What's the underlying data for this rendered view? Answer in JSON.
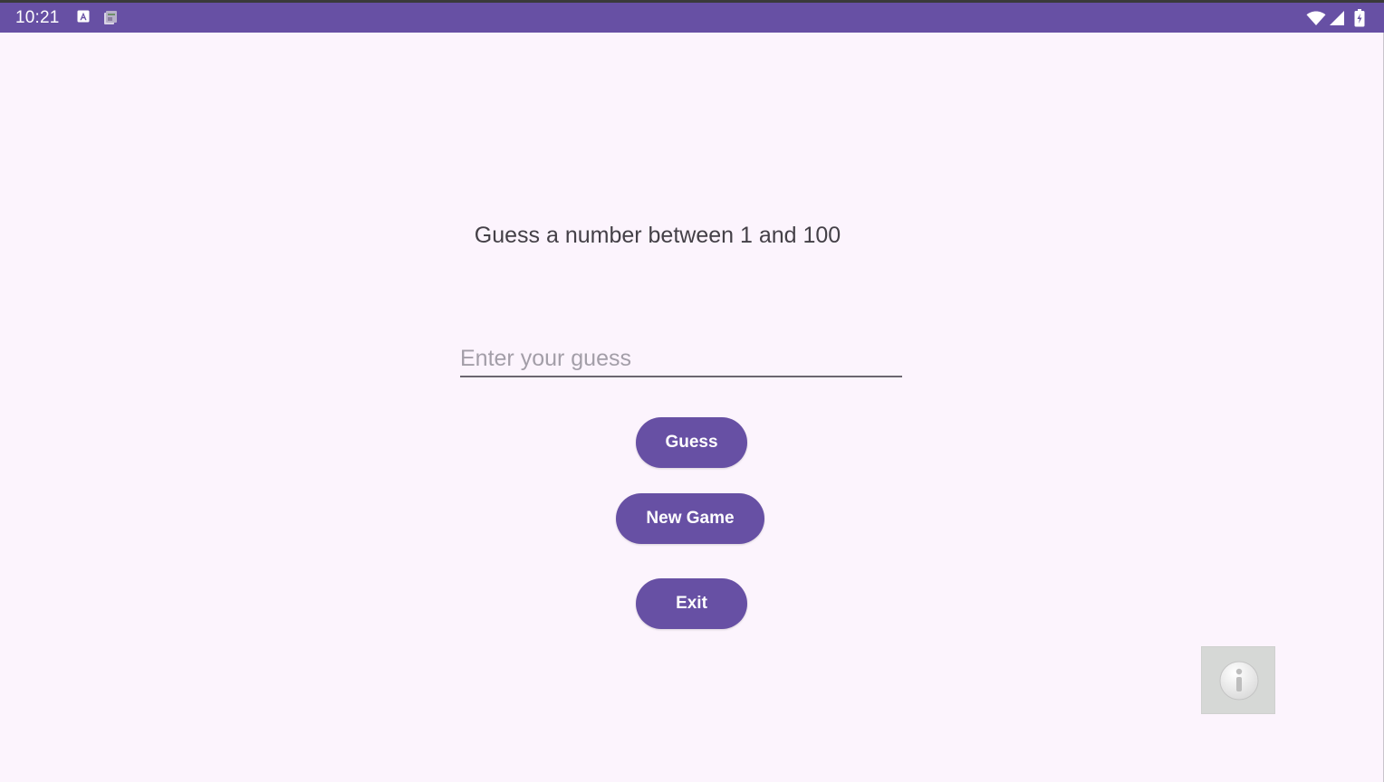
{
  "status_bar": {
    "time": "10:21",
    "icons": [
      "a-notification-icon",
      "app-notification-icon",
      "wifi-icon",
      "signal-icon",
      "battery-icon"
    ],
    "background": "#6750a4"
  },
  "main": {
    "prompt": "Guess a number between 1 and 100",
    "guess_input": {
      "placeholder": "Enter your guess",
      "value": ""
    },
    "buttons": {
      "guess": "Guess",
      "new_game": "New Game",
      "exit": "Exit"
    },
    "info_icon": "info-icon"
  },
  "colors": {
    "primary": "#6750a4",
    "background": "#fcf4fd",
    "text": "#444047",
    "placeholder": "#a39ea8"
  }
}
